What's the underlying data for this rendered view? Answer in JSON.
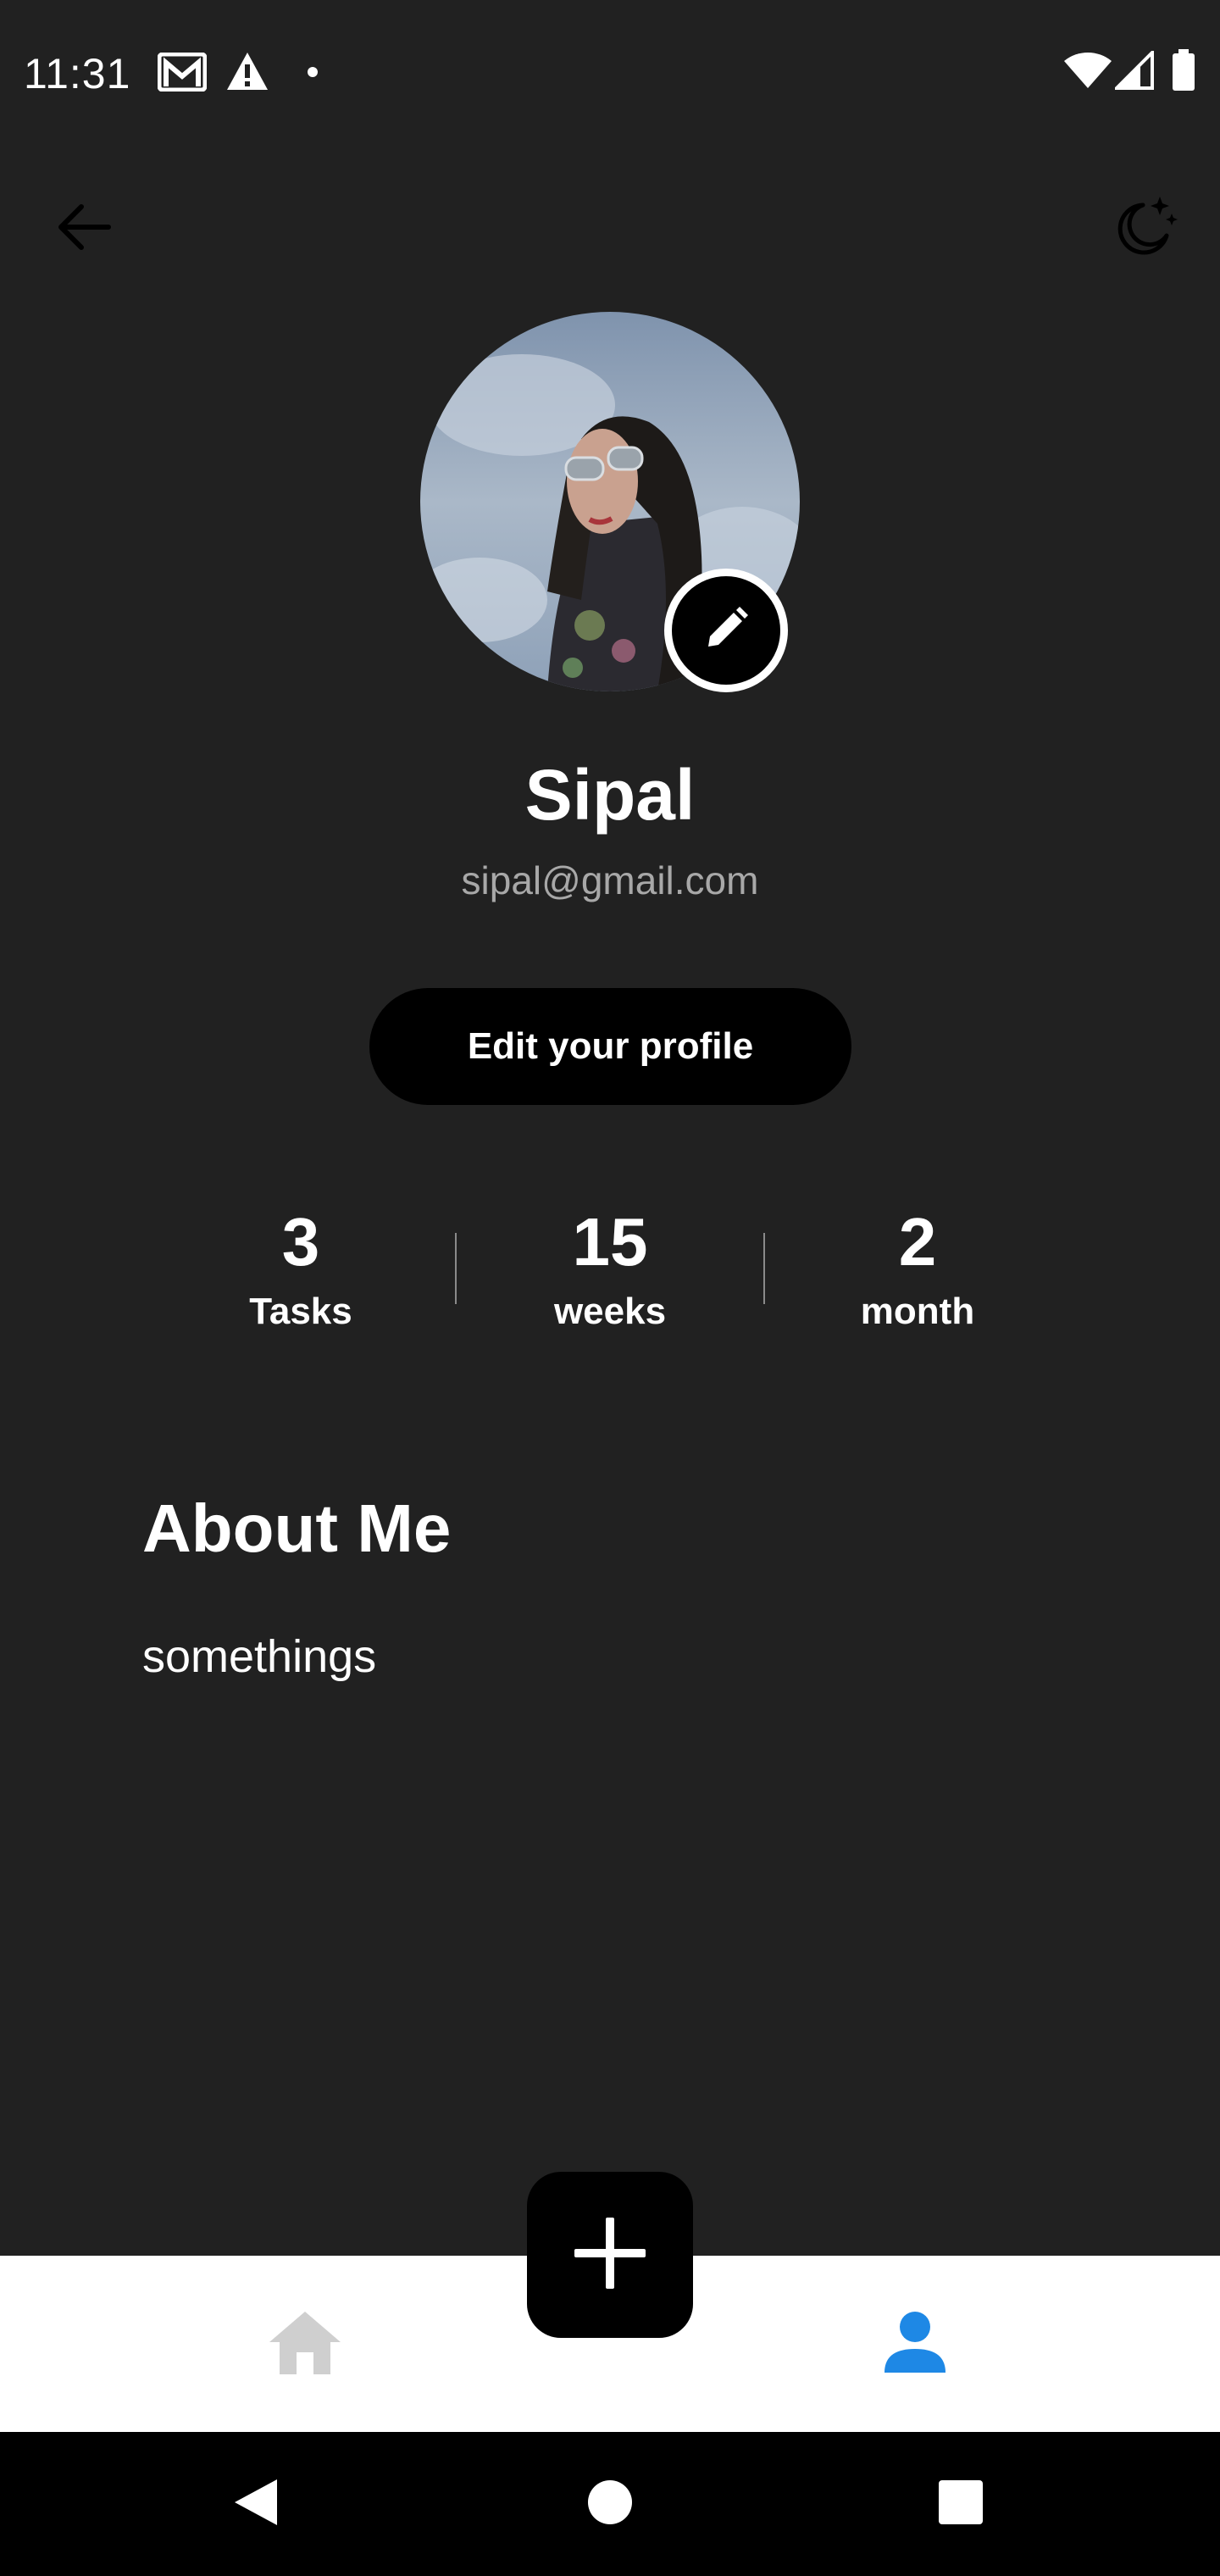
{
  "status_bar": {
    "time": "11:31",
    "left_icons": [
      "gmail-icon",
      "warning-icon",
      "dot-icon"
    ],
    "right_icons": [
      "wifi-icon",
      "signal-icon",
      "battery-icon"
    ]
  },
  "header": {
    "back_icon": "arrow-left-icon",
    "theme_icon": "moon-stars-icon"
  },
  "profile": {
    "name": "Sipal",
    "email": "sipal@gmail.com",
    "avatar_icon": "avatar-photo",
    "edit_avatar_icon": "pencil-icon",
    "edit_button_label": "Edit your profile"
  },
  "stats": [
    {
      "value": "3",
      "label": "Tasks"
    },
    {
      "value": "15",
      "label": "weeks"
    },
    {
      "value": "2",
      "label": "month"
    }
  ],
  "about": {
    "title": "About Me",
    "text": "somethings"
  },
  "bottom_nav": {
    "items": [
      {
        "icon": "home-icon",
        "active": false
      },
      {
        "icon": "person-icon",
        "active": true
      }
    ],
    "fab_icon": "plus-icon"
  },
  "system_nav": {
    "icons": [
      "back-triangle-icon",
      "home-circle-icon",
      "recents-square-icon"
    ]
  },
  "colors": {
    "background": "#212121",
    "accent": "#1e88e5",
    "inactive_nav": "#cfcfcf",
    "button_bg": "#000000",
    "muted_text": "#a8a8a8"
  }
}
